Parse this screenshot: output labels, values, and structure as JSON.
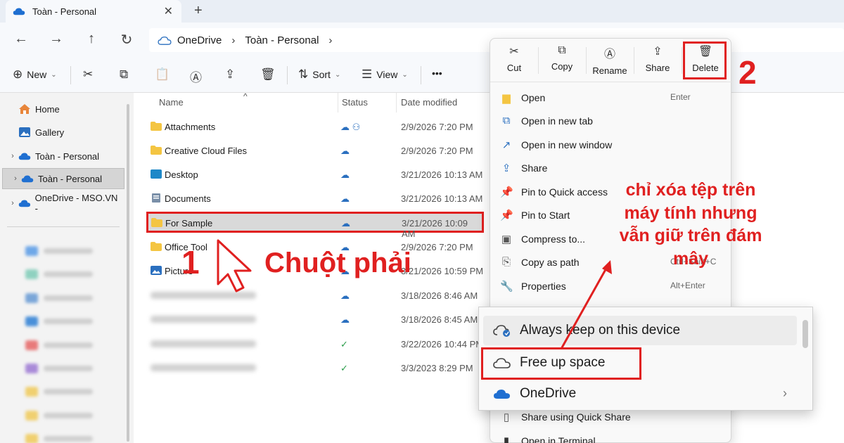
{
  "window": {
    "tab_title": "Toàn - Personal",
    "close_glyph": "✕",
    "new_tab_glyph": "+"
  },
  "nav": {
    "back": "←",
    "forward": "→",
    "up": "↑",
    "refresh": "↻"
  },
  "address": {
    "segments": [
      "OneDrive",
      "Toàn - Personal"
    ],
    "sep": "›"
  },
  "toolbar": {
    "new_label": "New",
    "sort_label": "Sort",
    "view_label": "View",
    "more": "•••"
  },
  "sidebar": {
    "items": [
      {
        "label": "Home",
        "expander": ""
      },
      {
        "label": "Gallery",
        "expander": ""
      },
      {
        "label": "Toàn - Personal",
        "expander": "›"
      },
      {
        "label": "Toàn - Personal",
        "expander": "›"
      },
      {
        "label": "OneDrive - MSO.VN -",
        "expander": "›"
      }
    ]
  },
  "list": {
    "columns": {
      "name": "Name",
      "status": "Status",
      "date": "Date modified"
    },
    "rows": [
      {
        "name": "Attachments",
        "status": "☁ ⚇",
        "date": "2/9/2026 7:20 PM"
      },
      {
        "name": "Creative Cloud Files",
        "status": "☁",
        "date": "2/9/2026 7:20 PM"
      },
      {
        "name": "Desktop",
        "status": "☁",
        "date": "3/21/2026 10:13 AM"
      },
      {
        "name": "Documents",
        "status": "☁",
        "date": "3/21/2026 10:13 AM"
      },
      {
        "name": "For Sample",
        "status": "☁",
        "date": "3/21/2026 10:09 AM"
      },
      {
        "name": "Office Tool",
        "status": "☁",
        "date": "2/9/2026 7:20 PM"
      },
      {
        "name": "Picture",
        "status": "☁",
        "date": "3/21/2026 10:59 PM"
      },
      {
        "name": "",
        "status": "☁",
        "date": "3/18/2026 8:46 AM"
      },
      {
        "name": "",
        "status": "☁",
        "date": "3/18/2026 8:45 AM"
      },
      {
        "name": "",
        "status": "✓",
        "date": "3/22/2026 10:44 PM"
      },
      {
        "name": "",
        "status": "✓",
        "date": "3/3/2023 8:29 PM"
      }
    ]
  },
  "context_menu": {
    "actions": [
      {
        "label": "Cut",
        "icon": "✂"
      },
      {
        "label": "Copy",
        "icon": "⧉"
      },
      {
        "label": "Rename",
        "icon": "Ⓐ"
      },
      {
        "label": "Share",
        "icon": "⇪"
      },
      {
        "label": "Delete",
        "icon": "🗑"
      }
    ],
    "items": [
      {
        "label": "Open",
        "shortcut": "Enter",
        "icon": "▆"
      },
      {
        "label": "Open in new tab",
        "shortcut": "",
        "icon": "⧉"
      },
      {
        "label": "Open in new window",
        "shortcut": "",
        "icon": "↗"
      },
      {
        "label": "Share",
        "shortcut": "",
        "icon": "⇪"
      },
      {
        "label": "Pin to Quick access",
        "shortcut": "",
        "icon": "📌"
      },
      {
        "label": "Pin to Start",
        "shortcut": "",
        "icon": "📌"
      },
      {
        "label": "Compress to...",
        "shortcut": "",
        "icon": "▣"
      },
      {
        "label": "Copy as path",
        "shortcut": "Ctrl+Shift+C",
        "icon": "⎘"
      },
      {
        "label": "Properties",
        "shortcut": "Alt+Enter",
        "icon": "🔧"
      },
      {
        "label": "Share using Quick Share",
        "shortcut": "",
        "icon": "▯"
      },
      {
        "label": "Open in Terminal",
        "shortcut": "",
        "icon": "▮"
      }
    ]
  },
  "submenu": {
    "items": [
      {
        "label": "Always keep on this device"
      },
      {
        "label": "Free up space"
      },
      {
        "label": "OneDrive"
      }
    ],
    "chevron": "›"
  },
  "annotations": {
    "step1": "1",
    "step2": "2",
    "right_click": "Chuột phải",
    "note": "chỉ xóa tệp trên máy tính nhưng vẫn giữ trên đám mây"
  },
  "colors": {
    "accent": "#2a6fbf",
    "annotation": "#e02020",
    "folder": "#f4c542"
  }
}
